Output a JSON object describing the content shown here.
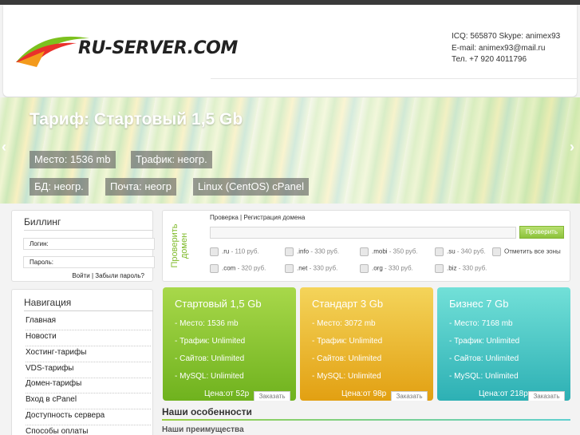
{
  "header": {
    "logo_text": "RU-SERVER.COM",
    "contacts": {
      "icq_skype": "ICQ: 565870 Skype: animex93",
      "email": "E-mail: animex93@mail.ru",
      "phone": "Тел. +7 920 4011796"
    }
  },
  "slider": {
    "title": "Тариф: Стартовый 1,5 Gb",
    "badges": [
      "Место: 1536 mb",
      "Трафик: неогр.",
      "БД: неогр.",
      "Почта: неогр",
      "Linux (CentOS) cPanel"
    ],
    "prev_arrow": "‹",
    "next_arrow": "›"
  },
  "billing": {
    "title": "Биллинг",
    "login_label": "Логин:",
    "password_label": "Пароль:",
    "links": "Войти | Забыли пароль?"
  },
  "navigation": {
    "title": "Навигация",
    "items": [
      "Главная",
      "Новости",
      "Хостинг-тарифы",
      "VDS-тарифы",
      "Домен-тарифы",
      "Вход в cPanel",
      "Доступность сервера",
      "Способы оплаты"
    ]
  },
  "domain": {
    "vertical_label_1": "Проверить",
    "vertical_label_2": "домен",
    "header": "Проверка | Регистрация домена",
    "button": "Проверить",
    "mark_all": "Отметить все зоны",
    "zones": [
      {
        "name": ".ru",
        "price": "- 110 руб."
      },
      {
        "name": ".info",
        "price": "- 330 руб."
      },
      {
        "name": ".mobi",
        "price": "- 350 руб."
      },
      {
        "name": ".su",
        "price": "- 340 руб."
      },
      {
        "name": ".com",
        "price": "- 320 руб."
      },
      {
        "name": ".net",
        "price": "- 330 руб."
      },
      {
        "name": ".org",
        "price": "- 330 руб."
      },
      {
        "name": ".biz",
        "price": "- 330 руб."
      }
    ]
  },
  "tariffs": [
    {
      "title": "Стартовый 1,5 Gb",
      "lines": [
        "- Место: 1536 mb",
        "- Трафик: Unlimited",
        "- Сайтов: Unlimited",
        "- MySQL: Unlimited"
      ],
      "price": "Цена:от 52р",
      "order": "Заказать",
      "color_top": "#a8d84a",
      "color_bottom": "#6fb21e"
    },
    {
      "title": "Стандарт 3 Gb",
      "lines": [
        "- Место: 3072 mb",
        "- Трафик: Unlimited",
        "- Сайтов: Unlimited",
        "- MySQL: Unlimited"
      ],
      "price": "Цена:от 98р",
      "order": "Заказать",
      "color_top": "#f4d45a",
      "color_bottom": "#e2a012"
    },
    {
      "title": "Бизнес 7 Gb",
      "lines": [
        "- Место: 7168 mb",
        "- Трафик: Unlimited",
        "- Сайтов: Unlimited",
        "- MySQL: Unlimited"
      ],
      "price": "Цена:от 218р",
      "order": "Заказать",
      "color_top": "#72e0d8",
      "color_bottom": "#2db0b4"
    }
  ],
  "features": {
    "title": "Наши особенности",
    "advantages_title": "Наши преимущества"
  }
}
